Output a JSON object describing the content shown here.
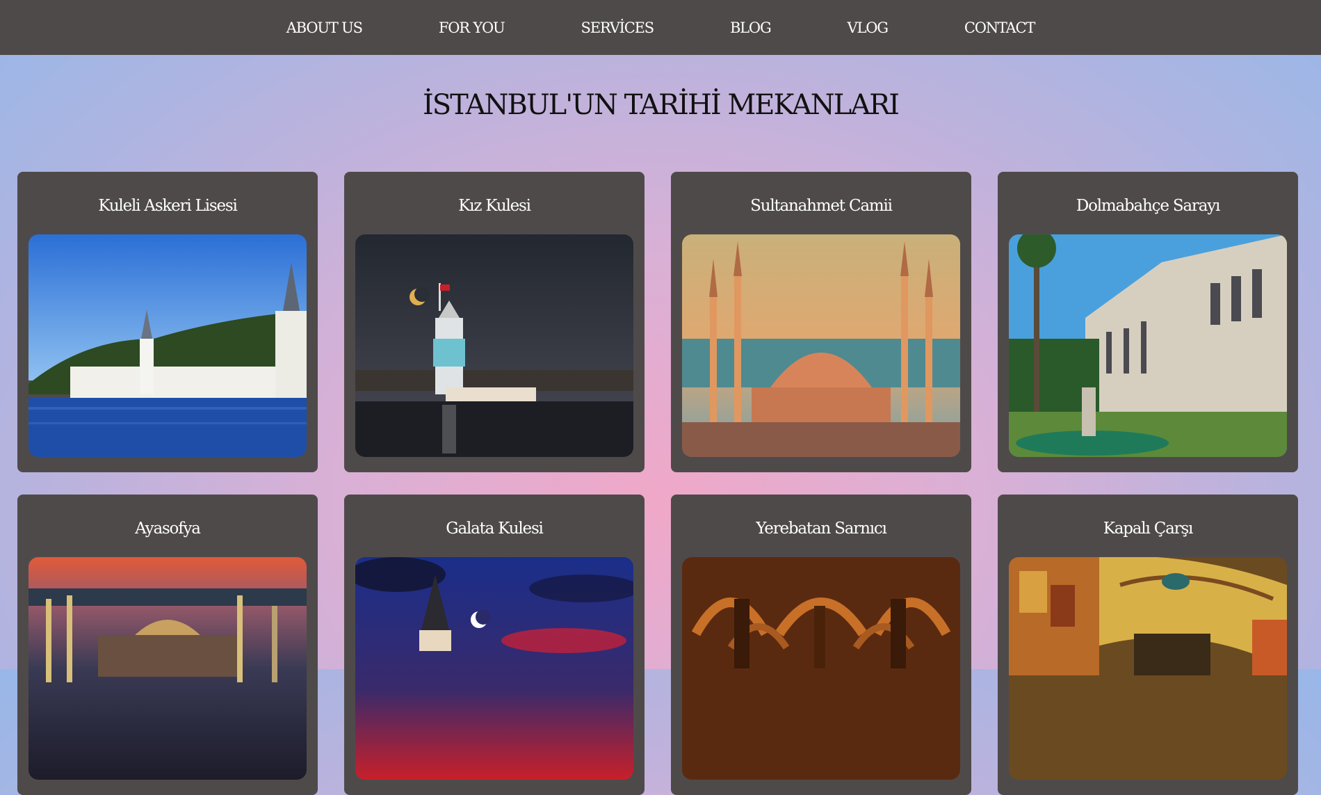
{
  "nav": {
    "items": [
      "ABOUT US",
      "FOR YOU",
      "SERVİCES",
      "BLOG",
      "VLOG",
      "CONTACT"
    ]
  },
  "page": {
    "title": "İSTANBUL'UN TARİHİ MEKANLARI"
  },
  "cards": [
    {
      "title": "Kuleli Askeri Lisesi"
    },
    {
      "title": "Kız Kulesi"
    },
    {
      "title": "Sultanahmet Camii"
    },
    {
      "title": "Dolmabahçe Sarayı"
    },
    {
      "title": "Ayasofya"
    },
    {
      "title": "Galata Kulesi"
    },
    {
      "title": "Yerebatan Sarnıcı"
    },
    {
      "title": "Kapalı Çarşı"
    }
  ],
  "colors": {
    "nav_bg": "#4f4a4a",
    "card_bg": "#4f4a4a",
    "text_light": "#ffffff",
    "title_text": "#111111"
  }
}
